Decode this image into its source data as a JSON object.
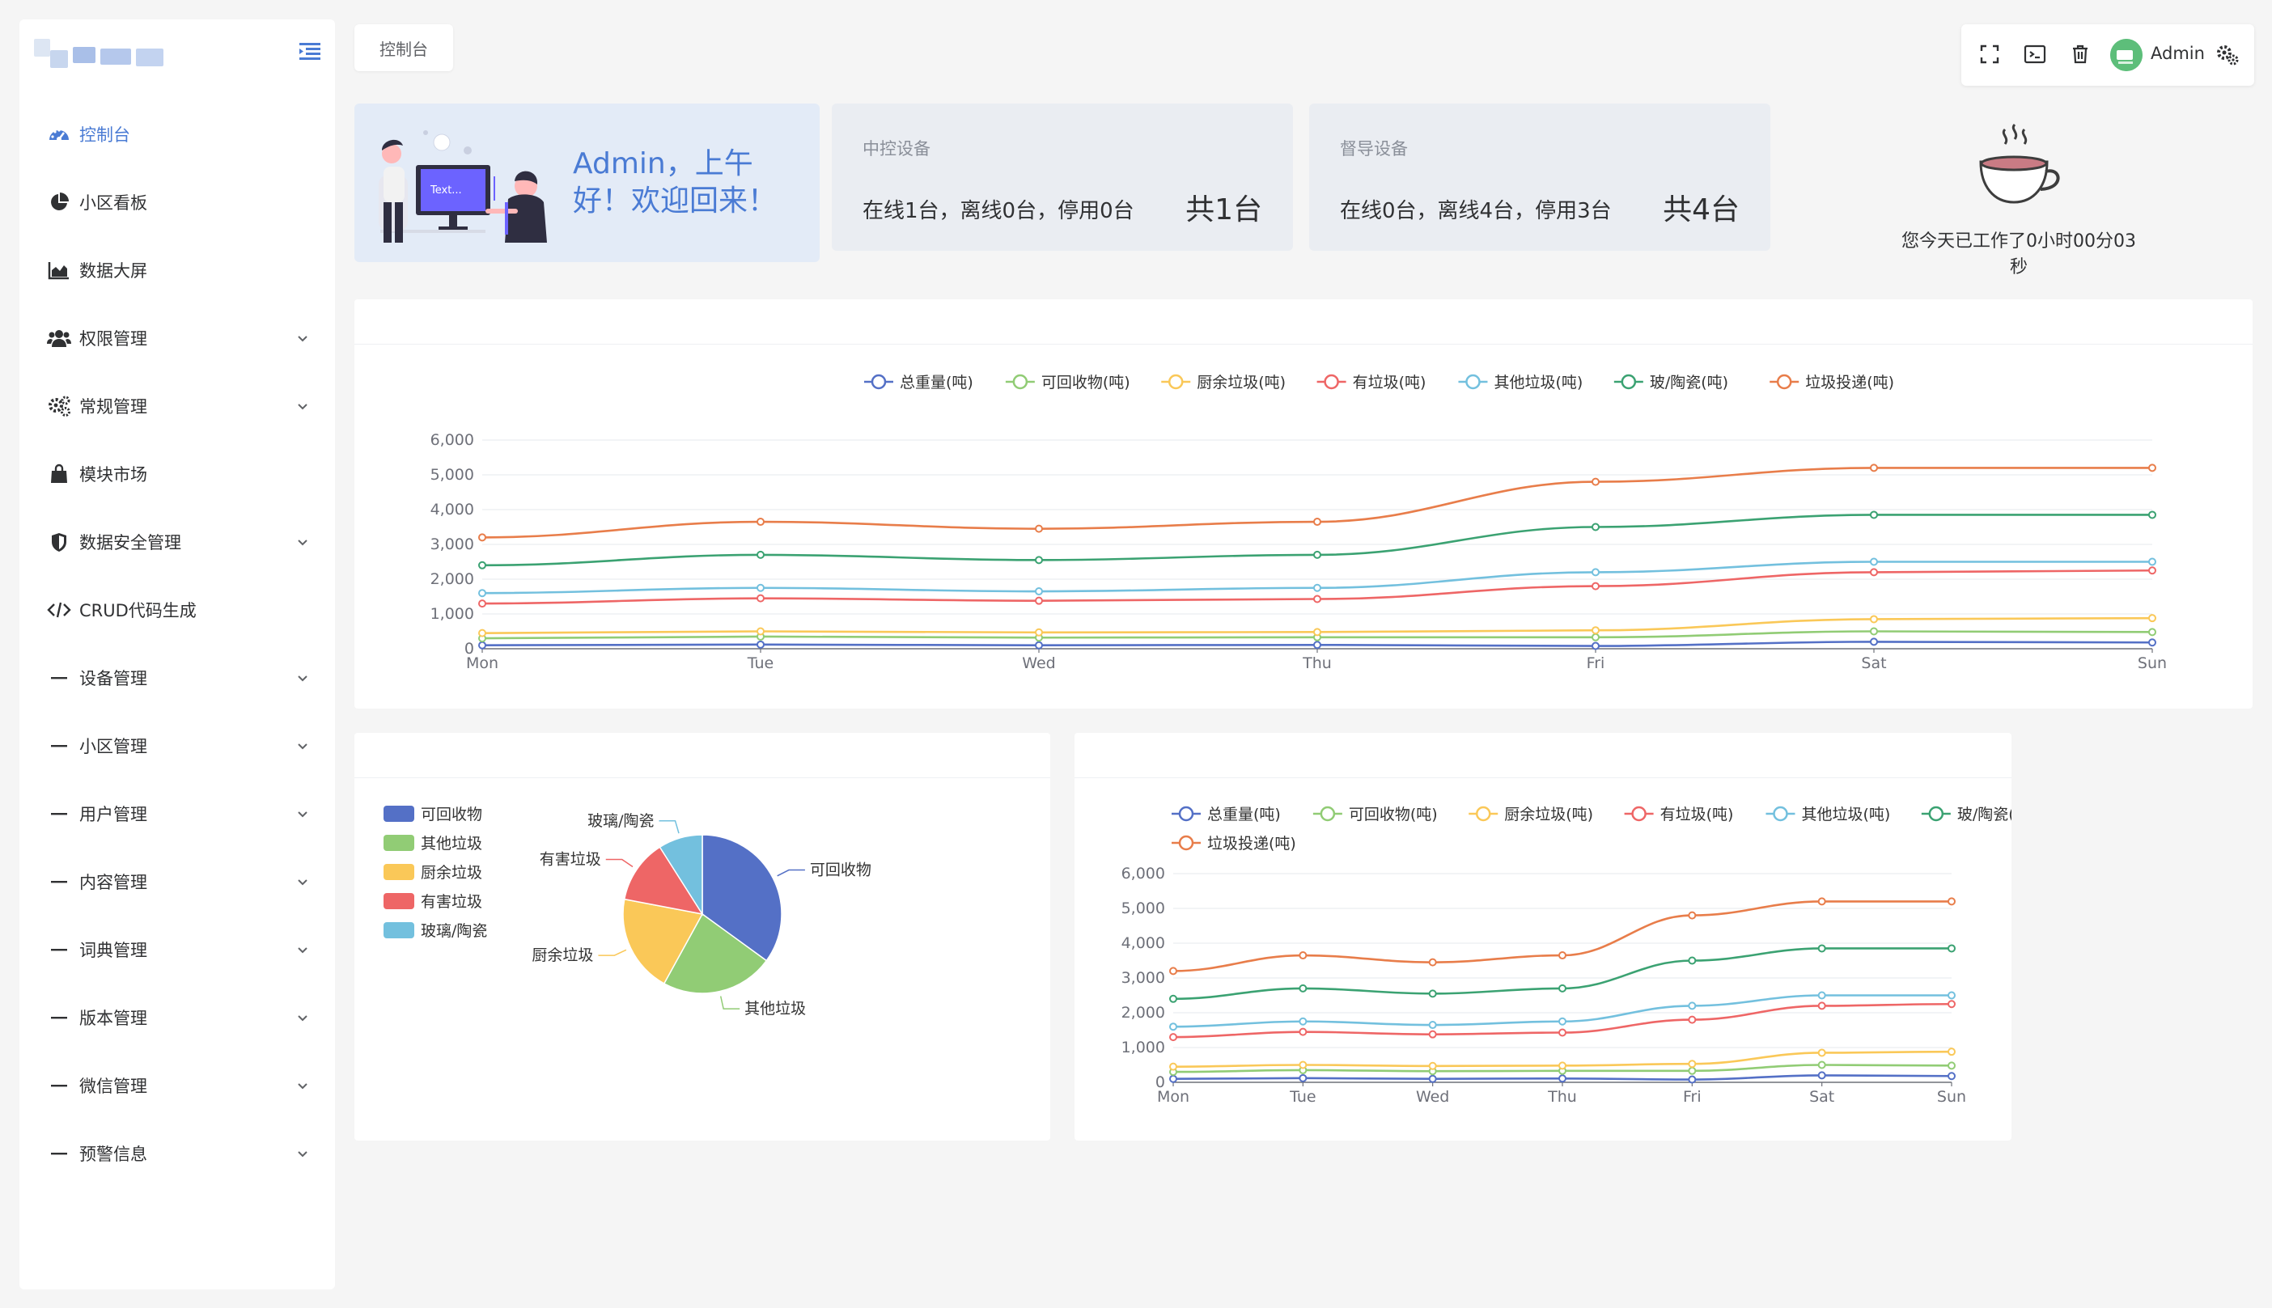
{
  "app": {
    "user_name": "Admin"
  },
  "sidebar": {
    "items": [
      {
        "label": "控制台",
        "icon": "dashboard-icon",
        "active": true,
        "expandable": false
      },
      {
        "label": "小区看板",
        "icon": "pie-chart-icon",
        "active": false,
        "expandable": false
      },
      {
        "label": "数据大屏",
        "icon": "area-chart-icon",
        "active": false,
        "expandable": false
      },
      {
        "label": "权限管理",
        "icon": "users-icon",
        "active": false,
        "expandable": true
      },
      {
        "label": "常规管理",
        "icon": "cogs-icon",
        "active": false,
        "expandable": true
      },
      {
        "label": "模块市场",
        "icon": "shopping-bag-icon",
        "active": false,
        "expandable": false
      },
      {
        "label": "数据安全管理",
        "icon": "shield-icon",
        "active": false,
        "expandable": true
      },
      {
        "label": "CRUD代码生成",
        "icon": "code-icon",
        "active": false,
        "expandable": false
      },
      {
        "label": "设备管理",
        "icon": "dash-icon",
        "active": false,
        "expandable": true
      },
      {
        "label": "小区管理",
        "icon": "dash-icon",
        "active": false,
        "expandable": true
      },
      {
        "label": "用户管理",
        "icon": "dash-icon",
        "active": false,
        "expandable": true
      },
      {
        "label": "内容管理",
        "icon": "dash-icon",
        "active": false,
        "expandable": true
      },
      {
        "label": "词典管理",
        "icon": "dash-icon",
        "active": false,
        "expandable": true
      },
      {
        "label": "版本管理",
        "icon": "dash-icon",
        "active": false,
        "expandable": true
      },
      {
        "label": "微信管理",
        "icon": "dash-icon",
        "active": false,
        "expandable": true
      },
      {
        "label": "预警信息",
        "icon": "dash-icon",
        "active": false,
        "expandable": true
      }
    ]
  },
  "nav": {
    "tab_label": "控制台"
  },
  "welcome": {
    "line1": "Admin，上午",
    "line2": "好！欢迎回来！"
  },
  "devices": {
    "central": {
      "title": "中控设备",
      "status": "在线1台，离线0台，停用0台",
      "total": "共1台"
    },
    "supervision": {
      "title": "督导设备",
      "status": "在线0台，离线4台，停用3台",
      "total": "共4台"
    }
  },
  "work_time": "您今天已工作了0小时00分03秒",
  "chart_data": [
    {
      "type": "line",
      "categories": [
        "Mon",
        "Tue",
        "Wed",
        "Thu",
        "Fri",
        "Sat",
        "Sun"
      ],
      "ylim": [
        0,
        6000
      ],
      "yticks": [
        "0",
        "1,000",
        "2,000",
        "3,000",
        "4,000",
        "5,000",
        "6,000"
      ],
      "legend_position": "top-center",
      "series": [
        {
          "name": "总重量(吨)",
          "color": "#5470c6",
          "values": [
            100,
            120,
            100,
            110,
            80,
            200,
            180
          ]
        },
        {
          "name": "可回收物(吨)",
          "color": "#91cc75",
          "values": [
            300,
            350,
            320,
            330,
            330,
            500,
            480
          ]
        },
        {
          "name": "厨余垃圾(吨)",
          "color": "#fac858",
          "values": [
            450,
            500,
            470,
            480,
            530,
            850,
            880
          ]
        },
        {
          "name": "有垃圾(吨)",
          "color": "#ee6666",
          "values": [
            1300,
            1450,
            1380,
            1430,
            1800,
            2200,
            2250
          ]
        },
        {
          "name": "其他垃圾(吨)",
          "color": "#73c0de",
          "values": [
            1600,
            1750,
            1650,
            1750,
            2200,
            2500,
            2500
          ]
        },
        {
          "name": "玻/陶瓷(吨)",
          "color": "#3ba272",
          "values": [
            2400,
            2700,
            2550,
            2700,
            3500,
            3850,
            3850
          ]
        },
        {
          "name": "垃圾投递(吨)",
          "color": "#e87d4a",
          "values": [
            3200,
            3650,
            3450,
            3650,
            4800,
            5200,
            5200
          ]
        }
      ]
    },
    {
      "type": "pie",
      "legend_position": "left",
      "slices": [
        {
          "name": "可回收物",
          "value": 35,
          "color": "#5470c6"
        },
        {
          "name": "其他垃圾",
          "value": 23,
          "color": "#91cc75"
        },
        {
          "name": "厨余垃圾",
          "value": 20,
          "color": "#fac858"
        },
        {
          "name": "有害垃圾",
          "value": 13,
          "color": "#ee6666"
        },
        {
          "name": "玻璃/陶瓷",
          "value": 9,
          "color": "#73c0de"
        }
      ]
    },
    {
      "type": "line",
      "categories": [
        "Mon",
        "Tue",
        "Wed",
        "Thu",
        "Fri",
        "Sat",
        "Sun"
      ],
      "ylim": [
        0,
        6000
      ],
      "yticks": [
        "0",
        "1,000",
        "2,000",
        "3,000",
        "4,000",
        "5,000",
        "6,000"
      ],
      "legend_position": "top-center",
      "series": [
        {
          "name": "总重量(吨)",
          "color": "#5470c6",
          "values": [
            100,
            120,
            100,
            110,
            80,
            200,
            180
          ]
        },
        {
          "name": "可回收物(吨)",
          "color": "#91cc75",
          "values": [
            300,
            350,
            320,
            330,
            330,
            500,
            480
          ]
        },
        {
          "name": "厨余垃圾(吨)",
          "color": "#fac858",
          "values": [
            450,
            500,
            470,
            480,
            530,
            850,
            880
          ]
        },
        {
          "name": "有垃圾(吨)",
          "color": "#ee6666",
          "values": [
            1300,
            1450,
            1380,
            1430,
            1800,
            2200,
            2250
          ]
        },
        {
          "name": "其他垃圾(吨)",
          "color": "#73c0de",
          "values": [
            1600,
            1750,
            1650,
            1750,
            2200,
            2500,
            2500
          ]
        },
        {
          "name": "玻/陶瓷(吨)",
          "color": "#3ba272",
          "values": [
            2400,
            2700,
            2550,
            2700,
            3500,
            3850,
            3850
          ]
        },
        {
          "name": "垃圾投递(吨)",
          "color": "#e87d4a",
          "values": [
            3200,
            3650,
            3450,
            3650,
            4800,
            5200,
            5200
          ]
        }
      ]
    }
  ]
}
